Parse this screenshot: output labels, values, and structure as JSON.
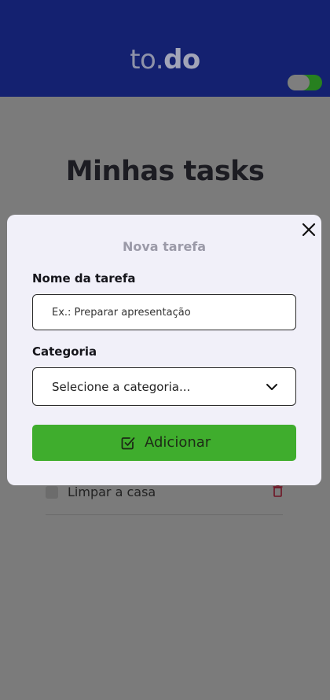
{
  "header": {
    "logo_prefix": "to.",
    "logo_suffix": "do",
    "theme_toggle": {
      "state": "on",
      "accent": "#27801f"
    },
    "background": "#142170"
  },
  "main": {
    "title": "Minhas tasks",
    "tasks": [
      {
        "label": "Limpar a casa",
        "checked": false
      }
    ]
  },
  "modal": {
    "title": "Nova tarefa",
    "name_label": "Nome da tarefa",
    "name_placeholder": "Ex.: Preparar apresentação",
    "category_label": "Categoria",
    "category_value": "Selecione a categoria...",
    "submit_label": "Adicionar",
    "submit_color": "#3fad2d",
    "icons": [
      "close-icon",
      "chevron-down-icon",
      "check-square-icon",
      "trash-icon"
    ]
  }
}
